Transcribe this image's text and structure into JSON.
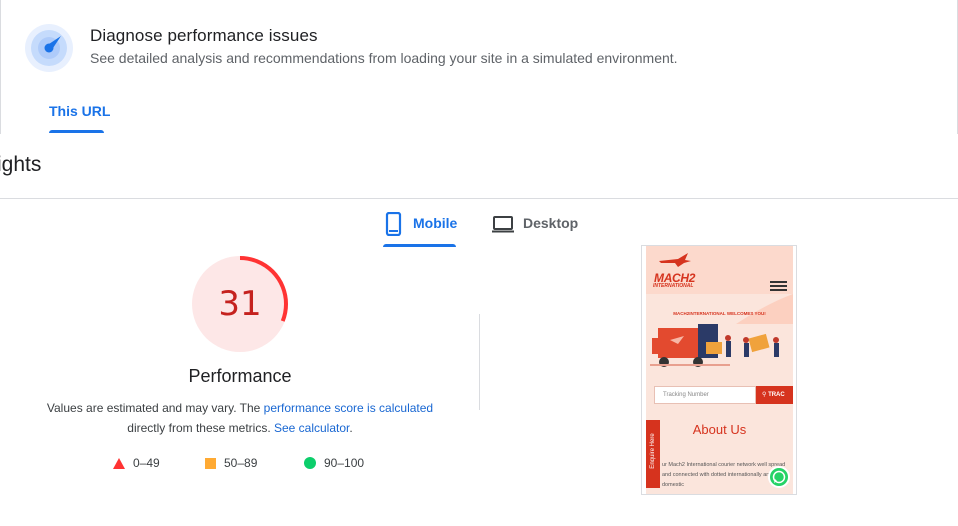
{
  "header": {
    "title": "Diagnose performance issues",
    "subtitle": "See detailed analysis and recommendations from loading your site in a simulated environment.",
    "tab_label": "This URL"
  },
  "insights_heading": "ights",
  "device_tabs": {
    "mobile": "Mobile",
    "desktop": "Desktop",
    "selected": "Mobile"
  },
  "score": {
    "value": "31",
    "fraction": 0.31,
    "label": "Performance",
    "color": "#c5221f",
    "desc_before": "Values are estimated and may vary. The ",
    "desc_link1": "performance score is calculated",
    "desc_mid": "directly from these metrics. ",
    "desc_link2": "See calculator",
    "desc_end": "."
  },
  "legend": {
    "fail": "0–49",
    "average": "50–89",
    "pass": "90–100",
    "colors": {
      "fail": "#ff3333",
      "average": "#ffaa33",
      "pass": "#0cce6b"
    }
  },
  "site_preview": {
    "logo": "MACH2",
    "logo_sub": "INTERNATIONAL",
    "welcome": "MACH2INTERNATIONAL WELCOMES YOU!",
    "tracking_placeholder": "Tracking Number",
    "track_button": "TRAC",
    "about_heading": "About Us",
    "enquire": "Enquire Here",
    "paragraph": "ur Mach2 International courier network well spread and connected with dotted internationally and domestic"
  }
}
